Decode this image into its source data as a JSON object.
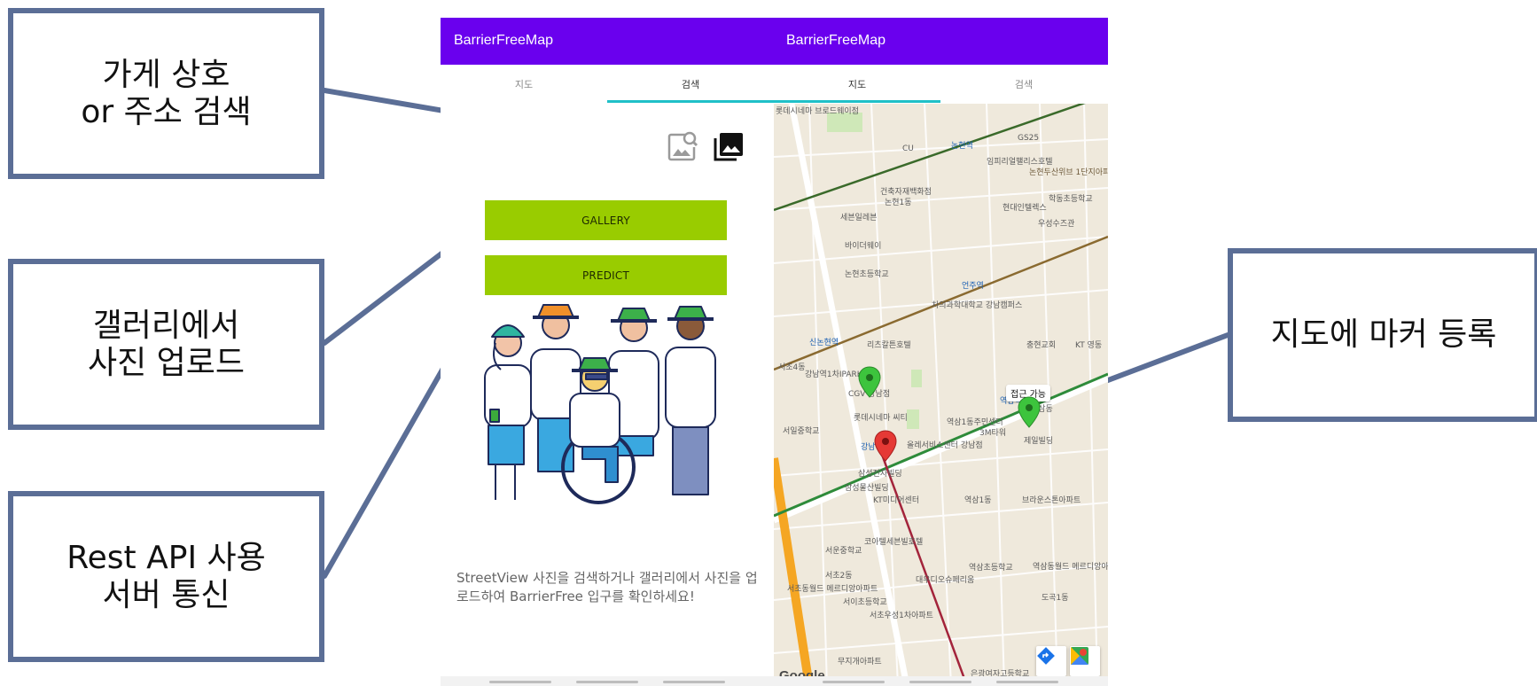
{
  "callouts": {
    "search": {
      "line1": "가게 상호",
      "line2": "or 주소 검색"
    },
    "gallery": {
      "line1": "갤러리에서",
      "line2": "사진 업로드"
    },
    "api": {
      "line1": "Rest API 사용",
      "line2": "서버 통신"
    },
    "marker": {
      "line1": "지도에 마커 등록"
    }
  },
  "app": {
    "title_left": "BarrierFreeMap",
    "title_right": "BarrierFreeMap",
    "tabs": [
      {
        "label": "지도"
      },
      {
        "label": "검색"
      },
      {
        "label": "지도"
      },
      {
        "label": "검색"
      }
    ],
    "accent_color": "#6a00ee",
    "tab_indicator_color": "#20c0c8"
  },
  "left_pane": {
    "icons": [
      "image-search-icon",
      "photo-library-icon"
    ],
    "gallery_button": "GALLERY",
    "predict_button": "PREDICT",
    "button_color": "#99cc00",
    "description": "StreetView 사진을 검색하거나 갤러리에서 사진을 업로드하여 BarrierFree 입구를 확인하세요!"
  },
  "map": {
    "tooltip": "접근 가능",
    "google_logo": "Google",
    "labels": {
      "l1": "롯데시네마 브로드웨이점",
      "l2": "GS25",
      "l3": "CU",
      "l4": "논현역",
      "l5": "임피리얼팰리스호텔",
      "l6": "건축자재백화점",
      "l7": "논현1동",
      "l8": "현대인텔렉스",
      "l9": "학동초등학교",
      "l10": "세븐일레븐",
      "l11": "바이더웨이",
      "l12": "우성수즈관",
      "l13": "논현초등학교",
      "l14": "언주역",
      "l15": "차의과학대학교 강남캠퍼스",
      "l16": "신논현역",
      "l17": "리츠칼튼호텔",
      "l18": "충현교회",
      "l19": "KT 영동",
      "l20": "강남역1차IPARK",
      "l21": "CGV 강남점",
      "l22": "역삼역",
      "l23": "역삼동",
      "l24": "롯데시네마 씨티",
      "l25": "서일중학교",
      "l26": "역삼1동주민센터",
      "l27": "3M타워",
      "l28": "강남역",
      "l29": "올레서비스센터 강남점",
      "l30": "제일빌딩",
      "l31": "삼성전자빌딩",
      "l32": "삼성물산빌딩",
      "l33": "KT미디어센터",
      "l34": "역삼1동",
      "l35": "브라운스톤아파트",
      "l36": "서운중학교",
      "l37": "코아텔세븐빌호텔",
      "l38": "서초2동",
      "l39": "대우디오슈페리움",
      "l40": "역삼초등학교",
      "l41": "역삼동월드 메르디앙아파트",
      "l42": "서이초등학교",
      "l43": "서초우성1차아파트",
      "l44": "도곡1동",
      "l45": "무지개아파트",
      "l46": "은광여자고등학교",
      "l47": "서초4동",
      "l48": "서초동월드 메르디앙아파트",
      "l49": "논현두산위브 1단지아파트"
    }
  }
}
